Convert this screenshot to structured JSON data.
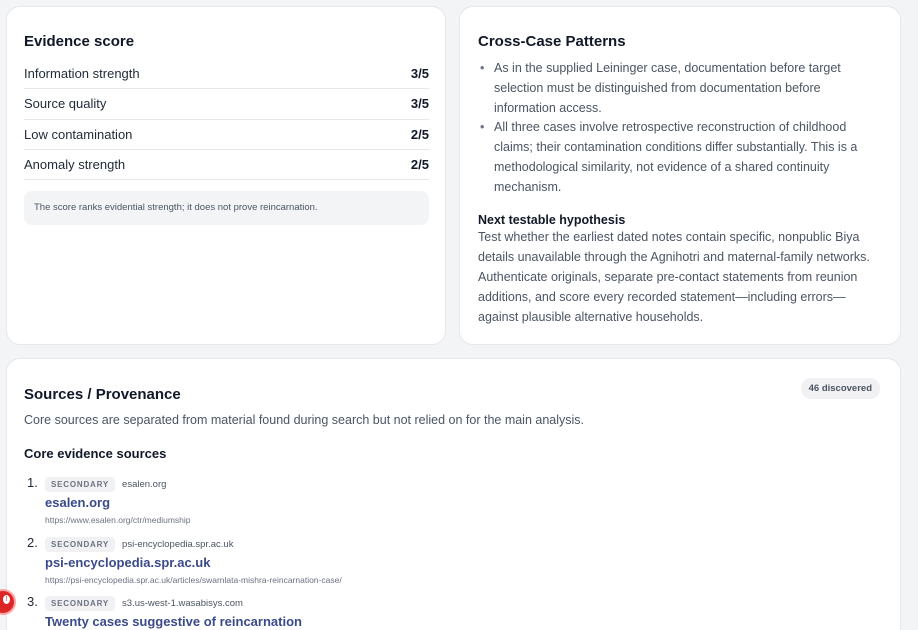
{
  "evidence": {
    "title": "Evidence score",
    "rows": [
      {
        "label": "Information strength",
        "value": "3/5"
      },
      {
        "label": "Source quality",
        "value": "3/5"
      },
      {
        "label": "Low contamination",
        "value": "2/5"
      },
      {
        "label": "Anomaly strength",
        "value": "2/5"
      }
    ],
    "note": "The score ranks evidential strength; it does not prove reincarnation."
  },
  "patterns": {
    "title": "Cross-Case Patterns",
    "bullets": [
      "As in the supplied Leininger case, documentation before target selection must be distinguished from documentation before information access.",
      "All three cases involve retrospective reconstruction of childhood claims; their contamination conditions differ substantially. This is a methodological similarity, not evidence of a shared continuity mechanism."
    ],
    "hypothesis_title": "Next testable hypothesis",
    "hypothesis_body": "Test whether the earliest dated notes contain specific, nonpublic Biya details unavailable through the Agnihotri and maternal-family networks. Authenticate originals, separate pre-contact statements from reunion additions, and score every recorded statement—including errors—against plausible alternative households."
  },
  "sources": {
    "title": "Sources / Provenance",
    "count_badge": "46 discovered",
    "description": "Core sources are separated from material found during search but not relied on for the main analysis.",
    "core_title": "Core evidence sources",
    "items": [
      {
        "num": "1.",
        "tag": "SECONDARY",
        "domain": "esalen.org",
        "title": "esalen.org",
        "url": "https://www.esalen.org/ctr/mediumship"
      },
      {
        "num": "2.",
        "tag": "SECONDARY",
        "domain": "psi-encyclopedia.spr.ac.uk",
        "title": "psi-encyclopedia.spr.ac.uk",
        "url": "https://psi-encyclopedia.spr.ac.uk/articles/swarnlata-mishra-reincarnation-case/"
      },
      {
        "num": "3.",
        "tag": "SECONDARY",
        "domain": "s3.us-west-1.wasabisys.com",
        "title": "Twenty cases suggestive of reincarnation",
        "url": ""
      }
    ]
  },
  "colors": {
    "accent": "#3b4a8a",
    "fab": "#dc2626"
  }
}
